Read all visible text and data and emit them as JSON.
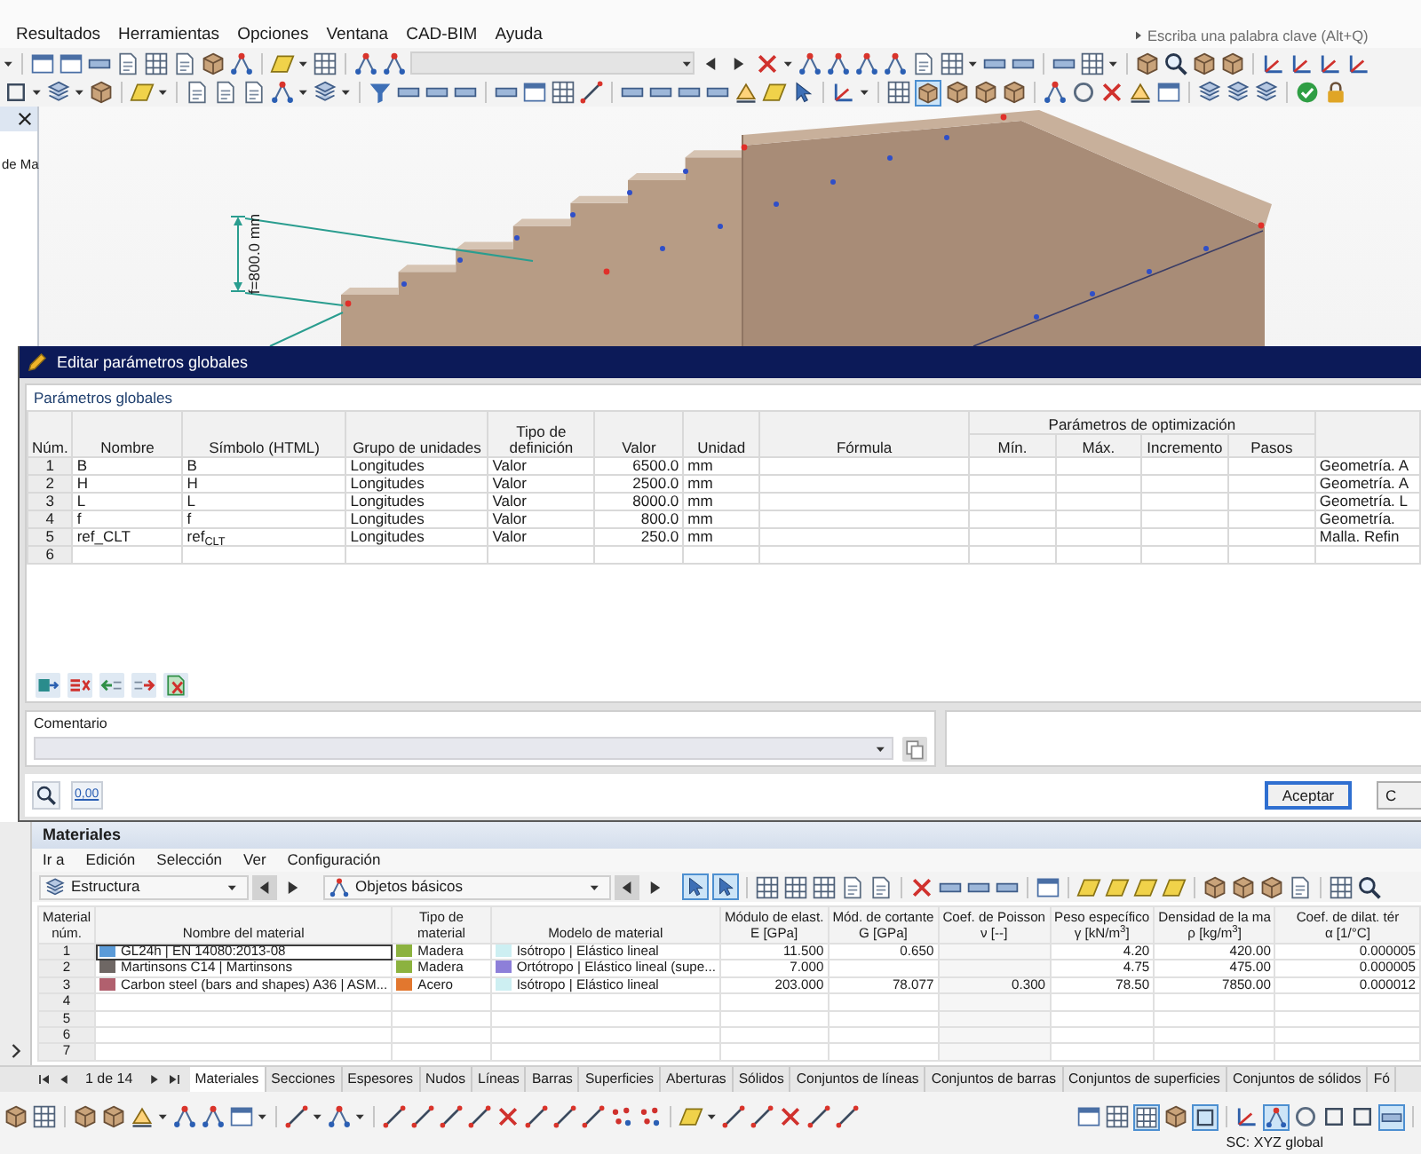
{
  "menu_bar": {
    "items": [
      "Resultados",
      "Herramientas",
      "Opciones",
      "Ventana",
      "CAD-BIM",
      "Ayuda"
    ],
    "search": {
      "placeholder": "Escriba una palabra clave (Alt+Q)"
    }
  },
  "toolbars": [
    {
      "combo": {
        "disabled": true
      }
    },
    {
      "toggles": [
        {
          "on": true
        }
      ]
    }
  ],
  "navigator": {
    "text": "de Ma"
  },
  "model_view": {
    "dimension_label": "f=800.0 mm"
  },
  "dialog": {
    "title": "Editar parámetros globales",
    "section": "Parámetros globales",
    "table": {
      "group_header": "Parámetros de optimización",
      "columns": [
        "Núm.",
        "Nombre",
        "Símbolo (HTML)",
        "Grupo de unidades",
        "Tipo de definición",
        "Valor",
        "Unidad",
        "Fórmula",
        "Mín.",
        "Máx.",
        "Incremento",
        "Pasos"
      ],
      "rows": [
        {
          "num": "1",
          "name": "B",
          "symbol": "B",
          "unit_group": "Longitudes",
          "definition_type": "Valor",
          "value": "6500.0",
          "unit": "mm",
          "column_13": "Geometría. A"
        },
        {
          "num": "2",
          "name": "H",
          "symbol": "H",
          "unit_group": "Longitudes",
          "definition_type": "Valor",
          "value": "2500.0",
          "unit": "mm",
          "column_13": "Geometría. A"
        },
        {
          "num": "3",
          "name": "L",
          "symbol": "L",
          "unit_group": "Longitudes",
          "definition_type": "Valor",
          "value": "8000.0",
          "unit": "mm",
          "column_13": "Geometría. L"
        },
        {
          "num": "4",
          "name": "f",
          "symbol": "f",
          "unit_group": "Longitudes",
          "definition_type": "Valor",
          "value": "800.0",
          "unit": "mm",
          "column_13": "Geometría."
        },
        {
          "num": "5",
          "name": "ref_CLT",
          "symbol": "ref$_{CLT}$",
          "unit_group": "Longitudes",
          "definition_type": "Valor",
          "value": "250.0",
          "unit": "mm",
          "column_13": "Malla. Refin"
        },
        {
          "num": "6"
        }
      ]
    },
    "comment": {
      "label": "Comentario"
    },
    "decimals_button": "0,00",
    "buttons": [
      {
        "label": "Aceptar",
        "default": true
      },
      {
        "label": "C",
        "default": false
      }
    ]
  },
  "materials": {
    "title": "Materiales",
    "menu": [
      "Ir a",
      "Edición",
      "Selección",
      "Ver",
      "Configuración"
    ],
    "selectors": [
      "Estructura",
      "Objetos básicos"
    ],
    "toolbar_toggles": [
      {
        "on": true
      },
      {
        "on": true
      }
    ],
    "table": {
      "columns": [
        [
          "Material",
          "núm."
        ],
        [
          "Nombre del material"
        ],
        [
          "Tipo de",
          "material"
        ],
        [
          "Modelo de material"
        ],
        [
          "Módulo de elast.",
          "E [GPa]"
        ],
        [
          "Mód. de cortante",
          "G [GPa]"
        ],
        [
          "Coef. de Poisson",
          "ν [--]"
        ],
        [
          "Peso específico",
          "γ [kN/m$^{3}$]"
        ],
        [
          "Densidad de la ma",
          "ρ [kg/m$^{3}$]"
        ],
        [
          "Coef. de dilat. tér",
          "α [1/°C]"
        ]
      ],
      "rows": [
        {
          "num": "1",
          "selected": true,
          "name": {
            "text": "GL24h | EN 14080:2013-08",
            "color": "#5b9bd8"
          },
          "type": {
            "text": "Madera",
            "color": "#8cb23f"
          },
          "model": {
            "text": "Isótropo | Elástico lineal",
            "color": "#cdeff2"
          },
          "elastic_modulus": "11.500",
          "shear_modulus": "0.650",
          "specific_weight": "4.20",
          "density": "420.00",
          "thermal_coefficient": "0.000005"
        },
        {
          "num": "2",
          "selected": false,
          "name": {
            "text": "Martinsons C14 | Martinsons",
            "color": "#6e6764"
          },
          "type": {
            "text": "Madera",
            "color": "#8cb23f"
          },
          "model": {
            "text": "Ortótropo | Elástico lineal (supe...",
            "color": "#8d7fd9"
          },
          "elastic_modulus": "7.000",
          "specific_weight": "4.75",
          "density": "475.00",
          "thermal_coefficient": "0.000005"
        },
        {
          "num": "3",
          "selected": false,
          "name": {
            "text": "Carbon steel (bars and shapes) A36 | ASM...",
            "color": "#b1606e"
          },
          "type": {
            "text": "Acero",
            "color": "#e2772e"
          },
          "model": {
            "text": "Isótropo | Elástico lineal",
            "color": "#cdeff2"
          },
          "elastic_modulus": "203.000",
          "shear_modulus": "78.077",
          "poisson_ratio": "0.300",
          "specific_weight": "78.50",
          "density": "7850.00",
          "thermal_coefficient": "0.000012"
        },
        {
          "num": "4",
          "selected": false
        },
        {
          "num": "5",
          "selected": false
        },
        {
          "num": "6",
          "selected": false
        },
        {
          "num": "7",
          "selected": false
        }
      ]
    },
    "pager": "1 de 14",
    "tabs": [
      {
        "label": "Materiales",
        "selected": true
      },
      {
        "label": "Secciones",
        "selected": false
      },
      {
        "label": "Espesores",
        "selected": false
      },
      {
        "label": "Nudos",
        "selected": false
      },
      {
        "label": "Líneas",
        "selected": false
      },
      {
        "label": "Barras",
        "selected": false
      },
      {
        "label": "Superficies",
        "selected": false
      },
      {
        "label": "Aberturas",
        "selected": false
      },
      {
        "label": "Sólidos",
        "selected": false
      },
      {
        "label": "Conjuntos de líneas",
        "selected": false
      },
      {
        "label": "Conjuntos de barras",
        "selected": false
      },
      {
        "label": "Conjuntos de superficies",
        "selected": false
      },
      {
        "label": "Conjuntos de sólidos",
        "selected": false
      },
      {
        "label": "Fó",
        "selected": false
      }
    ]
  },
  "bottom_toolbar": {
    "toggles": [
      {
        "on": true
      },
      {
        "on": true
      },
      {
        "on": true
      },
      {
        "on": true
      }
    ]
  },
  "status_bar": {
    "coordinate_system": "SC: XYZ global"
  }
}
